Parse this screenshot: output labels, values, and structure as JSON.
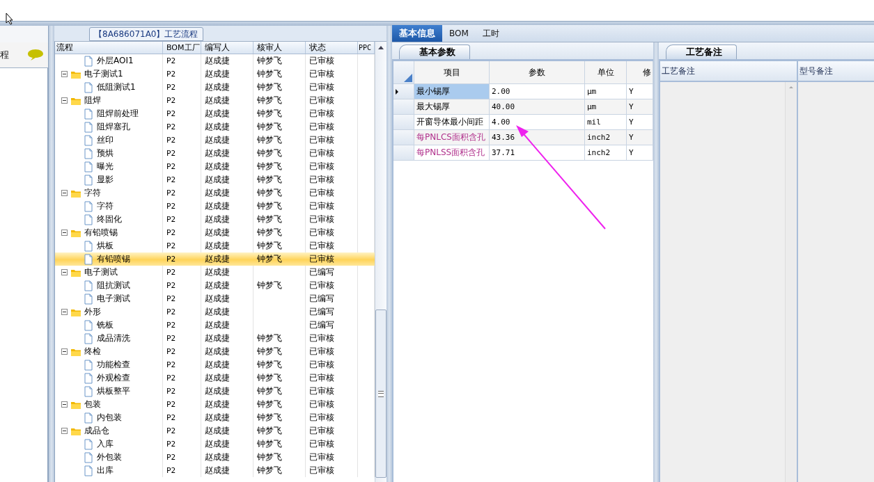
{
  "process_panel": {
    "title": "【8A686071A0】工艺流程",
    "side_label": "程",
    "columns": [
      "流程",
      "BOM工厂",
      "编写人",
      "核审人",
      "状态",
      "PPC"
    ],
    "rows": [
      {
        "name": "外层AOI1",
        "kind": "file",
        "factory": "P2",
        "author": "赵成捷",
        "reviewer": "钟梦飞",
        "status": "已审核",
        "selected": false
      },
      {
        "name": "电子测试1",
        "kind": "folder",
        "expanded": true,
        "factory": "P2",
        "author": "赵成捷",
        "reviewer": "钟梦飞",
        "status": "已审核",
        "selected": false,
        "children": [
          {
            "name": "低阻测试1",
            "kind": "file",
            "factory": "P2",
            "author": "赵成捷",
            "reviewer": "钟梦飞",
            "status": "已审核",
            "selected": false
          }
        ]
      },
      {
        "name": "阻焊",
        "kind": "folder",
        "expanded": true,
        "factory": "P2",
        "author": "赵成捷",
        "reviewer": "钟梦飞",
        "status": "已审核",
        "selected": false,
        "children": [
          {
            "name": "阻焊前处理",
            "kind": "file",
            "factory": "P2",
            "author": "赵成捷",
            "reviewer": "钟梦飞",
            "status": "已审核",
            "selected": false
          },
          {
            "name": "阻焊塞孔",
            "kind": "file",
            "factory": "P2",
            "author": "赵成捷",
            "reviewer": "钟梦飞",
            "status": "已审核",
            "selected": false
          },
          {
            "name": "丝印",
            "kind": "file",
            "factory": "P2",
            "author": "赵成捷",
            "reviewer": "钟梦飞",
            "status": "已审核",
            "selected": false
          },
          {
            "name": "预烘",
            "kind": "file",
            "factory": "P2",
            "author": "赵成捷",
            "reviewer": "钟梦飞",
            "status": "已审核",
            "selected": false
          },
          {
            "name": "曝光",
            "kind": "file",
            "factory": "P2",
            "author": "赵成捷",
            "reviewer": "钟梦飞",
            "status": "已审核",
            "selected": false
          },
          {
            "name": "显影",
            "kind": "file",
            "factory": "P2",
            "author": "赵成捷",
            "reviewer": "钟梦飞",
            "status": "已审核",
            "selected": false
          }
        ]
      },
      {
        "name": "字符",
        "kind": "folder",
        "expanded": true,
        "factory": "P2",
        "author": "赵成捷",
        "reviewer": "钟梦飞",
        "status": "已审核",
        "selected": false,
        "children": [
          {
            "name": "字符",
            "kind": "file",
            "factory": "P2",
            "author": "赵成捷",
            "reviewer": "钟梦飞",
            "status": "已审核",
            "selected": false
          },
          {
            "name": "终固化",
            "kind": "file",
            "factory": "P2",
            "author": "赵成捷",
            "reviewer": "钟梦飞",
            "status": "已审核",
            "selected": false
          }
        ]
      },
      {
        "name": "有铅喷锡",
        "kind": "folder",
        "expanded": true,
        "factory": "P2",
        "author": "赵成捷",
        "reviewer": "钟梦飞",
        "status": "已审核",
        "selected": false,
        "children": [
          {
            "name": "烘板",
            "kind": "file",
            "factory": "P2",
            "author": "赵成捷",
            "reviewer": "钟梦飞",
            "status": "已审核",
            "selected": false
          },
          {
            "name": "有铅喷锡",
            "kind": "file",
            "factory": "P2",
            "author": "赵成捷",
            "reviewer": "钟梦飞",
            "status": "已审核",
            "selected": true
          }
        ]
      },
      {
        "name": "电子测试",
        "kind": "folder",
        "expanded": true,
        "factory": "P2",
        "author": "赵成捷",
        "status": "已编写",
        "selected": false,
        "children": [
          {
            "name": "阻抗测试",
            "kind": "file",
            "factory": "P2",
            "author": "赵成捷",
            "reviewer": "钟梦飞",
            "status": "已审核",
            "selected": false
          },
          {
            "name": "电子测试",
            "kind": "file",
            "factory": "P2",
            "author": "赵成捷",
            "status": "已编写",
            "selected": false
          }
        ]
      },
      {
        "name": "外形",
        "kind": "folder",
        "expanded": true,
        "factory": "P2",
        "author": "赵成捷",
        "status": "已编写",
        "selected": false,
        "children": [
          {
            "name": "铣板",
            "kind": "file",
            "factory": "P2",
            "author": "赵成捷",
            "status": "已编写",
            "selected": false
          },
          {
            "name": "成品清洗",
            "kind": "file",
            "factory": "P2",
            "author": "赵成捷",
            "reviewer": "钟梦飞",
            "status": "已审核",
            "selected": false
          }
        ]
      },
      {
        "name": "终检",
        "kind": "folder",
        "expanded": true,
        "factory": "P2",
        "author": "赵成捷",
        "reviewer": "钟梦飞",
        "status": "已审核",
        "selected": false,
        "children": [
          {
            "name": "功能检查",
            "kind": "file",
            "factory": "P2",
            "author": "赵成捷",
            "reviewer": "钟梦飞",
            "status": "已审核",
            "selected": false
          },
          {
            "name": "外观检查",
            "kind": "file",
            "factory": "P2",
            "author": "赵成捷",
            "reviewer": "钟梦飞",
            "status": "已审核",
            "selected": false
          },
          {
            "name": "烘板整平",
            "kind": "file",
            "factory": "P2",
            "author": "赵成捷",
            "reviewer": "钟梦飞",
            "status": "已审核",
            "selected": false
          }
        ]
      },
      {
        "name": "包装",
        "kind": "folder",
        "expanded": true,
        "factory": "P2",
        "author": "赵成捷",
        "reviewer": "钟梦飞",
        "status": "已审核",
        "selected": false,
        "children": [
          {
            "name": "内包装",
            "kind": "file",
            "factory": "P2",
            "author": "赵成捷",
            "reviewer": "钟梦飞",
            "status": "已审核",
            "selected": false
          }
        ]
      },
      {
        "name": "成品仓",
        "kind": "folder",
        "expanded": true,
        "factory": "P2",
        "author": "赵成捷",
        "reviewer": "钟梦飞",
        "status": "已审核",
        "selected": false,
        "children": [
          {
            "name": "入库",
            "kind": "file",
            "factory": "P2",
            "author": "赵成捷",
            "reviewer": "钟梦飞",
            "status": "已审核",
            "selected": false
          },
          {
            "name": "外包装",
            "kind": "file",
            "factory": "P2",
            "author": "赵成捷",
            "reviewer": "钟梦飞",
            "status": "已审核",
            "selected": false
          },
          {
            "name": "出库",
            "kind": "file",
            "factory": "P2",
            "author": "赵成捷",
            "reviewer": "钟梦飞",
            "status": "已审核",
            "selected": false
          }
        ]
      }
    ]
  },
  "tabs": [
    {
      "label": "基本信息",
      "selected": true
    },
    {
      "label": "BOM",
      "selected": false
    },
    {
      "label": "工时",
      "selected": false
    }
  ],
  "params": {
    "tab": "基本参数",
    "columns": [
      "项目",
      "参数",
      "单位",
      "修"
    ],
    "rows": [
      {
        "item": "最小锡厚",
        "value": "2.00",
        "unit": "μm",
        "flag": "Y",
        "current": true,
        "kind": "plain"
      },
      {
        "item": "最大锡厚",
        "value": "40.00",
        "unit": "μm",
        "flag": "Y",
        "current": false,
        "kind": "plain"
      },
      {
        "item": "开窗导体最小间距",
        "value": "4.00",
        "unit": "mil",
        "flag": "Y",
        "current": false,
        "kind": "plain"
      },
      {
        "item": "每PNLCS面积含孔",
        "value": "43.36",
        "unit": "inch2",
        "flag": "Y",
        "current": false,
        "kind": "derived"
      },
      {
        "item": "每PNLSS面积含孔",
        "value": "37.71",
        "unit": "inch2",
        "flag": "Y",
        "current": false,
        "kind": "derived"
      }
    ]
  },
  "notes": {
    "tab": "工艺备注",
    "columns": [
      "工艺备注",
      "型号备注"
    ]
  }
}
